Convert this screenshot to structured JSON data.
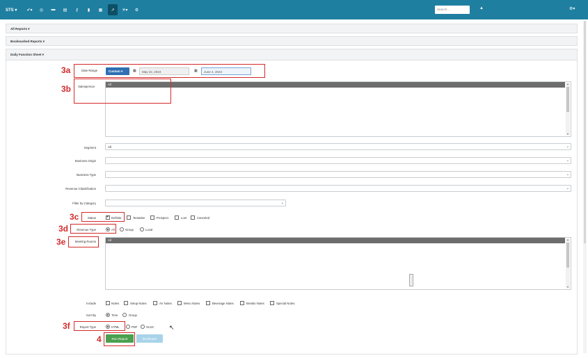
{
  "navbar": {
    "brand": "STS ▾",
    "icons": [
      {
        "name": "check-icon",
        "glyph": "✔▾"
      },
      {
        "name": "globe-icon",
        "glyph": "◎"
      },
      {
        "name": "folder-icon",
        "glyph": "▬"
      },
      {
        "name": "inbox-icon",
        "glyph": "▤"
      },
      {
        "name": "key-icon",
        "glyph": "⚷"
      },
      {
        "name": "bookmark-icon",
        "glyph": "▮"
      },
      {
        "name": "calendar-icon",
        "glyph": "▦"
      },
      {
        "name": "chart-icon",
        "glyph": "↗"
      },
      {
        "name": "user-plus-icon",
        "glyph": "✳▾"
      },
      {
        "name": "settings-icon",
        "glyph": "⚙"
      }
    ],
    "search_placeholder": "Search...",
    "user_icon": "▲",
    "gear_icon": "⚙▾"
  },
  "panels": {
    "all_reports": "All Reports ▾",
    "bookmarked_reports": "Bookmarked Reports ▾",
    "daily_function_sheet": "Daily Function Sheet ▾"
  },
  "form": {
    "date_range_label": "Date Range",
    "custom_button": "Custom ▾",
    "start_date": "May 22, 2023",
    "end_date": "June 4, 2023",
    "salesperson_label": "Salesperson",
    "salesperson_selected": "All",
    "segment_label": "Segment",
    "segment_value": "All",
    "business_origin_label": "Business Origin",
    "business_type_label": "Business Type",
    "revenue_classification_label": "Revenue Classification",
    "filter_by_category_label": "Filter by Category",
    "status_label": "Status",
    "status_options": [
      "Definite",
      "Tentative",
      "Prospect",
      "Lost",
      "Canceled"
    ],
    "revenue_type_label": "Revenue Type",
    "revenue_type_options": [
      "All",
      "Group",
      "Local"
    ],
    "meeting_rooms_label": "Meeting Rooms",
    "meeting_rooms_selected": "All",
    "include_label": "Include",
    "include_options": [
      "Notes",
      "Setup Notes",
      "AV Notes",
      "Menu Notes",
      "Beverage Notes",
      "Breaks Notes",
      "Special Notes"
    ],
    "sort_by_label": "Sort By",
    "sort_by_options": [
      "Time",
      "Group"
    ],
    "report_type_label": "Report Type",
    "report_type_options": [
      "HTML",
      "PDF",
      "XLSX"
    ],
    "run_report_button": "Run Report",
    "bookmark_button": "Bookmark"
  },
  "annotations": [
    "3a",
    "3b",
    "3c",
    "3d",
    "3e",
    "3f",
    "4"
  ]
}
